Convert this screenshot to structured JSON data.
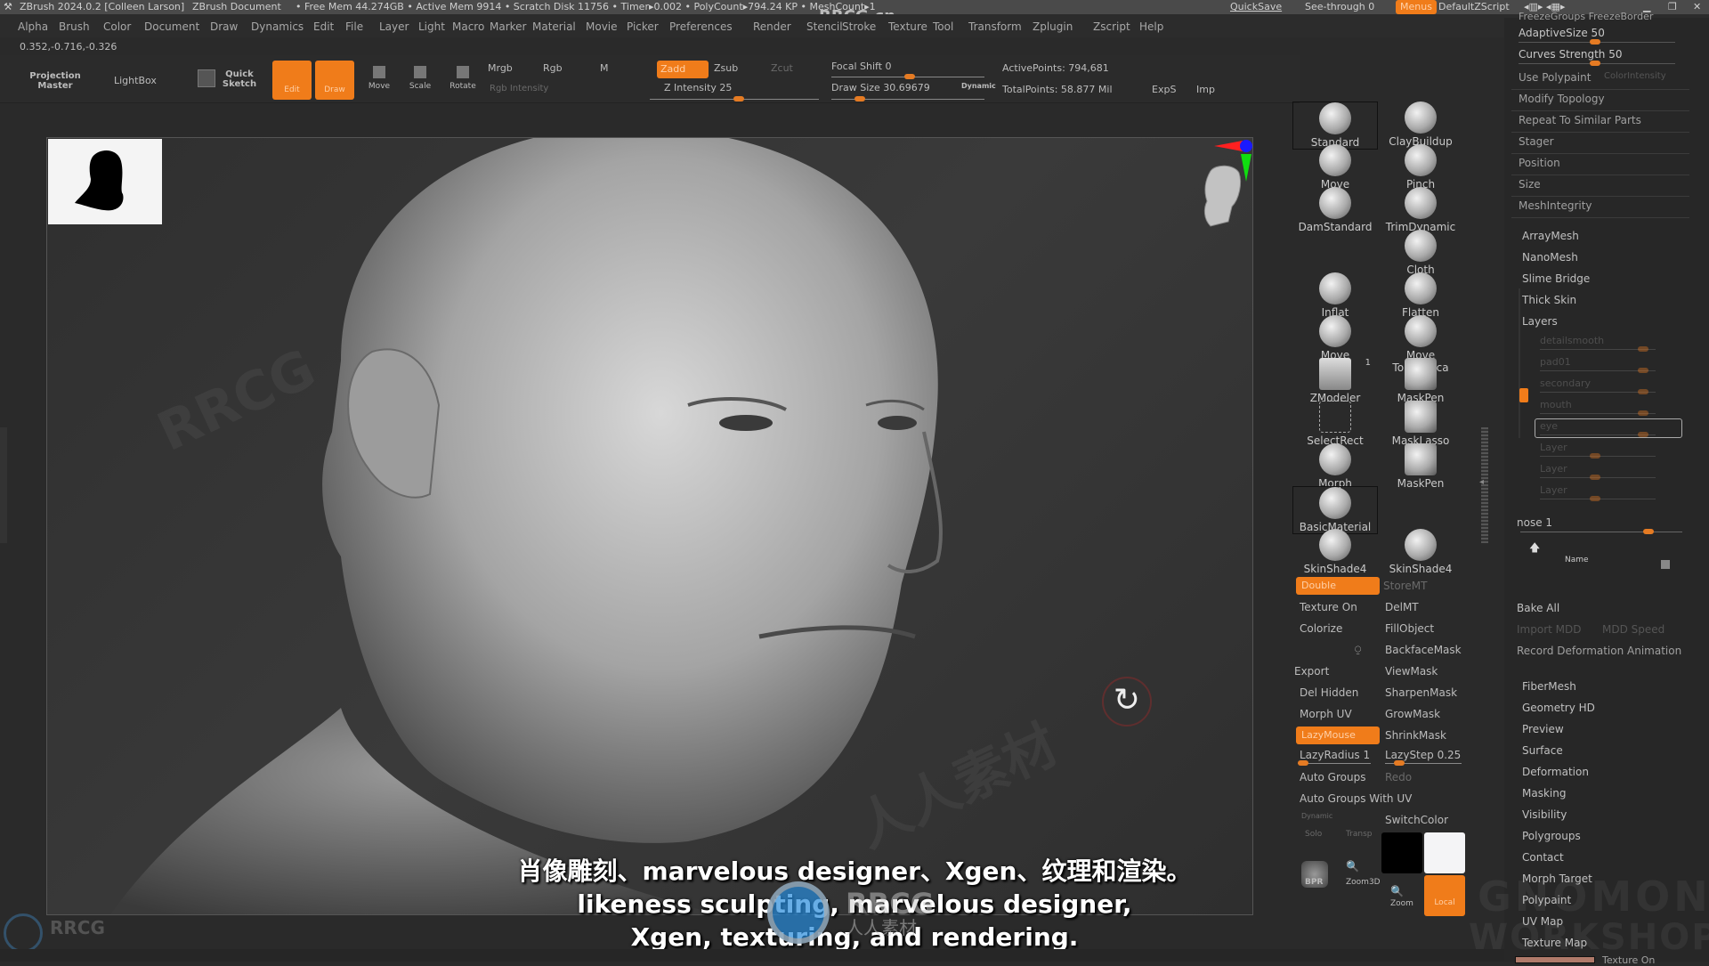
{
  "titlebar": {
    "app": "ZBrush 2024.0.2 [Colleen Larson]",
    "document": "ZBrush Document",
    "stats": "• Free Mem 44.274GB • Active Mem 9914 • Scratch Disk 11756 • Timer▸0.002 • PolyCount▸794.24 KP • MeshCount▸1",
    "quicksave": "QuickSave",
    "see_through": "See-through 0",
    "see_through_value": 0,
    "menus": "Menus",
    "default_zscript": "DefaultZScript",
    "watermark": "RRCG.cn"
  },
  "menubar": [
    "Alpha",
    "Brush",
    "Color",
    "Document",
    "Draw",
    "Dynamics",
    "Edit",
    "File",
    "Layer",
    "Light",
    "Macro",
    "Marker",
    "Material",
    "Movie",
    "Picker",
    "Preferences",
    "Render",
    "Stencil",
    "Stroke",
    "Texture",
    "Tool",
    "Transform",
    "Zplugin",
    "Zscript",
    "Help"
  ],
  "coords": "0.352,-0.716,-0.326",
  "toolbar": {
    "projection_master": "Projection Master",
    "lightbox": "LightBox",
    "quick_sketch": "Quick Sketch",
    "edit": "Edit",
    "draw": "Draw",
    "move": "Move",
    "scale": "Scale",
    "rotate": "Rotate",
    "mrgb": "Mrgb",
    "rgb": "Rgb",
    "m": "M",
    "rgb_intensity": "Rgb Intensity",
    "zadd": "Zadd",
    "zsub": "Zsub",
    "zcut": "Zcut",
    "z_intensity": "Z Intensity 25",
    "z_intensity_value": 25,
    "focal_shift": "Focal Shift 0",
    "focal_shift_value": 0,
    "draw_size": "Draw Size 30.69679",
    "draw_size_value": 30.69679,
    "dynamic": "Dynamic",
    "active_points": "ActivePoints: 794,681",
    "total_points": "TotalPoints: 58.877 Mil",
    "exps": "ExpS",
    "imp": "Imp"
  },
  "brushes": [
    {
      "name": "Standard",
      "selected": true
    },
    {
      "name": "ClayBuildup"
    },
    {
      "name": "Move"
    },
    {
      "name": "Pinch"
    },
    {
      "name": "DamStandard"
    },
    {
      "name": "TrimDynamic"
    },
    {
      "name": "Cloth"
    },
    {
      "name": "Inflat"
    },
    {
      "name": "Flatten"
    },
    {
      "name": "Move"
    },
    {
      "name": "Move Topologica"
    },
    {
      "name": "ZModeler",
      "badge": "1"
    },
    {
      "name": "MaskPen"
    },
    {
      "name": "SelectRect"
    },
    {
      "name": "MaskLasso"
    },
    {
      "name": "Morph"
    },
    {
      "name": "MaskPen"
    },
    {
      "name": "BasicMaterial",
      "selected": true
    },
    {
      "name": "SkinShade4"
    },
    {
      "name": "SkinShade4"
    }
  ],
  "left_buttons": {
    "double": "Double",
    "storemt": "StoreMT",
    "texture_on": "Texture On",
    "delmt": "DelMT",
    "colorize": "Colorize",
    "fillobject": "FillObject",
    "backfacemask": "BackfaceMask",
    "export": "Export",
    "viewmask": "ViewMask",
    "del_hidden": "Del Hidden",
    "sharpenmask": "SharpenMask",
    "morph_uv": "Morph UV",
    "growmask": "GrowMask",
    "lazymouse": "LazyMouse",
    "shrinkmask": "ShrinkMask",
    "lazyradius": "LazyRadius 1",
    "lazyradius_value": 1,
    "lazystep": "LazyStep 0.25",
    "lazystep_value": 0.25,
    "auto_groups": "Auto Groups",
    "redo": "Redo",
    "auto_groups_uv": "Auto Groups With UV",
    "dynamic": "Dynamic",
    "solo": "Solo",
    "transp": "Transp",
    "switchcolor": "SwitchColor",
    "bpr": "BPR",
    "zoom3d": "Zoom3D",
    "zoom": "Zoom",
    "local": "Local"
  },
  "right_panel": {
    "top_faded": "FreezeGroups  FreezeBorder",
    "adaptive_size": "AdaptiveSize 50",
    "adaptive_size_value": 50,
    "curves_strength": "Curves Strength 50",
    "curves_strength_value": 50,
    "use_polypaint": "Use Polypaint",
    "color_intensity": "ColorIntensity",
    "rows": [
      "Modify Topology",
      "Repeat To Similar Parts",
      "Stager",
      "Position",
      "Size",
      "MeshIntegrity"
    ],
    "subtools": [
      "ArrayMesh",
      "NanoMesh",
      "Slime Bridge",
      "Thick Skin",
      "Layers"
    ],
    "layers": [
      "detailsmooth",
      "pad01",
      "secondary",
      "mouth",
      "eye",
      "Layer",
      "Layer",
      "Layer"
    ],
    "nose_label": "nose 1",
    "nose_value": 1,
    "name_label": "Name",
    "bake_all": "Bake All",
    "import_mdd": "Import MDD",
    "mdd_speed": "MDD Speed",
    "record_deformation": "Record Deformation Animation",
    "sections": [
      "FiberMesh",
      "Geometry HD",
      "Preview",
      "Surface",
      "Deformation",
      "Masking",
      "Visibility",
      "Polygroups",
      "Contact",
      "Morph Target",
      "Polypaint",
      "UV Map",
      "Texture Map"
    ],
    "texture_on": "Texture On"
  },
  "subtitles": {
    "line1": "肖像雕刻、marvelous designer、Xgen、纹理和渲染。",
    "line2": "likeness sculpting, marvelous designer,",
    "line3": "Xgen, texturing, and rendering."
  },
  "watermarks": {
    "rrcg": "RRCG",
    "rrcg_cn": "人人素材",
    "gnomon": "GNOMON",
    "workshop": "WORKSHOP"
  },
  "colors": {
    "accent": "#f07c1a",
    "panel_bg": "#2b2b2b",
    "title_bg": "#4a4a4a"
  }
}
